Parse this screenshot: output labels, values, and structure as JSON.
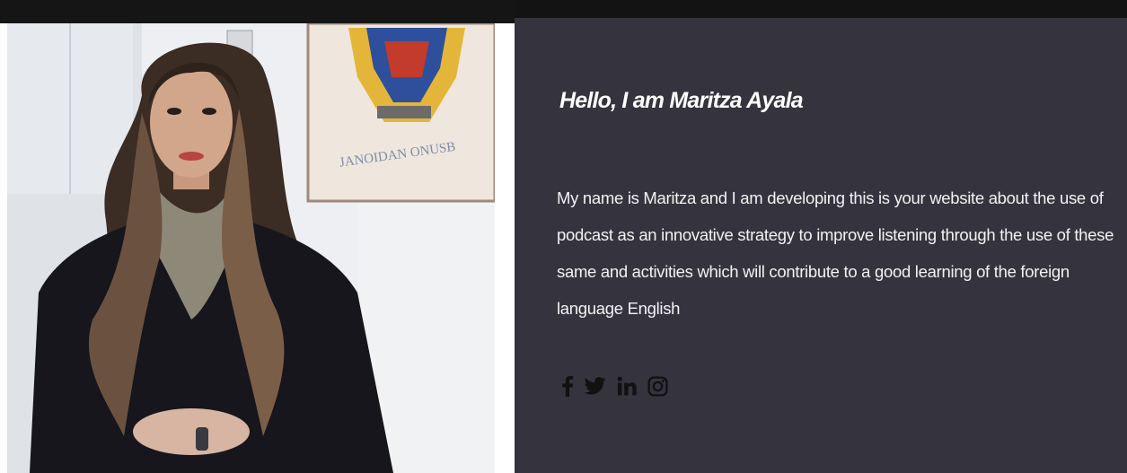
{
  "profile": {
    "heading": "Hello, I am Maritza Ayala",
    "bio": "My name is Maritza and I am developing this is your website about the use of podcast as an innovative strategy to improve listening through the use of these same and activities which will contribute to a good learning of the foreign language English"
  },
  "social": {
    "icons": [
      "facebook-icon",
      "twitter-icon",
      "linkedin-icon",
      "instagram-icon"
    ]
  },
  "colors": {
    "panel_background": "#35343e",
    "top_bar": "#131313",
    "heading_text": "#ffffff",
    "body_text": "#f2f2f2",
    "social_icons": "#111111"
  }
}
